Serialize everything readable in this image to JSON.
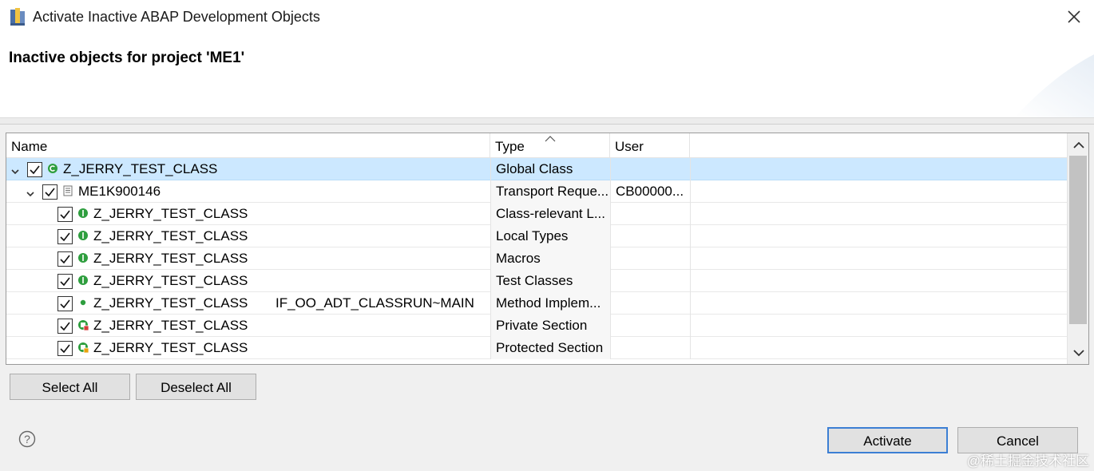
{
  "window": {
    "title": "Activate Inactive ABAP Development Objects"
  },
  "header": {
    "title": "Inactive objects for project 'ME1'"
  },
  "table": {
    "columns": {
      "name": "Name",
      "type": "Type",
      "user": "User"
    },
    "rows": [
      {
        "name": "Z_JERRY_TEST_CLASS",
        "extra": "",
        "type": "Global Class",
        "user": "",
        "level": 0,
        "icon": "class-icon",
        "icon_color": "#2e9e3e",
        "checked": true,
        "expanded": true
      },
      {
        "name": "ME1K900146",
        "extra": "",
        "type": "Transport Reque...",
        "user": "CB00000...",
        "level": 1,
        "icon": "transport-request-icon",
        "icon_color": "#707070",
        "checked": true,
        "expanded": true
      },
      {
        "name": "Z_JERRY_TEST_CLASS",
        "extra": "",
        "type": "Class-relevant L...",
        "user": "",
        "level": 2,
        "icon": "include-icon",
        "icon_color": "#2e9e3e",
        "checked": true
      },
      {
        "name": "Z_JERRY_TEST_CLASS",
        "extra": "",
        "type": "Local Types",
        "user": "",
        "level": 2,
        "icon": "include-icon",
        "icon_color": "#2e9e3e",
        "checked": true
      },
      {
        "name": "Z_JERRY_TEST_CLASS",
        "extra": "",
        "type": "Macros",
        "user": "",
        "level": 2,
        "icon": "include-icon",
        "icon_color": "#2e9e3e",
        "checked": true
      },
      {
        "name": "Z_JERRY_TEST_CLASS",
        "extra": "",
        "type": "Test Classes",
        "user": "",
        "level": 2,
        "icon": "include-icon",
        "icon_color": "#2e9e3e",
        "checked": true
      },
      {
        "name": "Z_JERRY_TEST_CLASS",
        "extra": "IF_OO_ADT_CLASSRUN~MAIN",
        "type": "Method Implem...",
        "user": "",
        "level": 2,
        "icon": "method-icon",
        "icon_color": "#2e9e3e",
        "checked": true
      },
      {
        "name": "Z_JERRY_TEST_CLASS",
        "extra": "",
        "type": "Private Section",
        "user": "",
        "level": 2,
        "icon": "private-section-icon",
        "icon_color": "#2e9e3e",
        "checked": true
      },
      {
        "name": "Z_JERRY_TEST_CLASS",
        "extra": "",
        "type": "Protected Section",
        "user": "",
        "level": 2,
        "icon": "protected-section-icon",
        "icon_color": "#2e9e3e",
        "checked": true
      }
    ]
  },
  "buttons": {
    "select_all": "Select All",
    "deselect_all": "Deselect All",
    "activate": "Activate",
    "cancel": "Cancel"
  },
  "watermark": "@稀土掘金技术社区",
  "colors": {
    "selection": "#cce8ff",
    "default_button_border": "#3c7fd4",
    "object_icon": "#2e9e3e"
  }
}
